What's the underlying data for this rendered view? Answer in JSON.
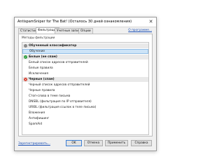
{
  "window": {
    "title": "AntispamSniper for The Bat! (Осталось 30 дней ознакомления)",
    "close_glyph": "✕"
  },
  "tabs": [
    {
      "label": "Статистика",
      "active": false
    },
    {
      "label": "Фильтрация",
      "active": true
    },
    {
      "label": "Учетные записи",
      "active": false
    },
    {
      "label": "Опции",
      "active": false
    }
  ],
  "program_link": "О программе...",
  "filter_methods_label": "Методы фильтрации",
  "filter_list": [
    {
      "kind": "group",
      "icon": "gray",
      "glyph": "",
      "label": "Обученный классификатор"
    },
    {
      "kind": "item",
      "label": "Обучение",
      "selected": true
    },
    {
      "kind": "group",
      "icon": "green",
      "glyph": "✓",
      "label": "Белые (не спам)"
    },
    {
      "kind": "item",
      "label": "Белый список адресов отправителей"
    },
    {
      "kind": "item",
      "label": "Белые правила"
    },
    {
      "kind": "item",
      "label": "Исключения"
    },
    {
      "kind": "group",
      "icon": "red",
      "glyph": "✕",
      "label": "Черные (спам)"
    },
    {
      "kind": "item",
      "label": "Черный список адресов отправителей"
    },
    {
      "kind": "item",
      "label": "Черные правила"
    },
    {
      "kind": "item",
      "label": "Стоп-слова в теме письма"
    },
    {
      "kind": "item",
      "label": "DNSBL (фильтрация по IP отправителя)"
    },
    {
      "kind": "item",
      "label": "URIBL (фильтрация ссылок в теле письма)"
    },
    {
      "kind": "item",
      "label": "Вложения"
    },
    {
      "kind": "item",
      "label": "Антифишинг"
    },
    {
      "kind": "item",
      "label": "SpamAid"
    }
  ],
  "footer": {
    "register_link": "Зарегистрировать...",
    "ok_label": "OK",
    "cancel_label": "Отмена",
    "apply_label": "Применить",
    "help_label": "Справка"
  },
  "colors": {
    "group_bg": "#e9e9e9",
    "selection_bg": "#cde4f7",
    "link": "#1a4fb5",
    "icon_gray": "#8c8c8c",
    "icon_green": "#2f9e3f",
    "icon_red": "#d43a2a"
  }
}
